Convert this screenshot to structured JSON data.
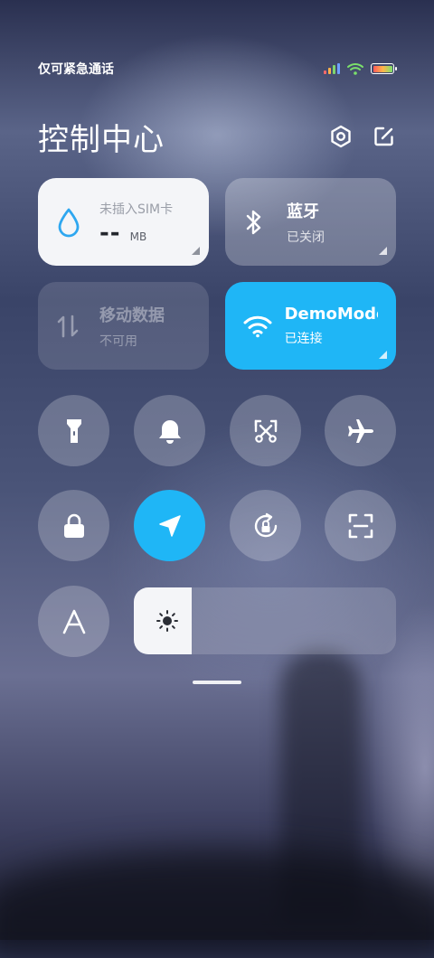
{
  "status_bar": {
    "carrier_text": "仅可紧急通话",
    "signal_icon": "signal-bars-icon",
    "wifi_icon": "wifi-icon",
    "battery_icon": "battery-icon"
  },
  "header": {
    "title": "控制中心",
    "settings_icon": "settings-hexagon-icon",
    "edit_icon": "edit-icon"
  },
  "tiles": {
    "data_usage": {
      "label": "未插入SIM卡",
      "value": "--",
      "unit": "MB",
      "icon": "water-drop-icon"
    },
    "bluetooth": {
      "title": "蓝牙",
      "status": "已关闭",
      "icon": "bluetooth-icon"
    },
    "mobile_data": {
      "title": "移动数据",
      "status": "不可用",
      "icon": "mobile-data-arrows-icon"
    },
    "wifi": {
      "title": "DemoMode",
      "status": "已连接",
      "icon": "wifi-icon"
    }
  },
  "toggles": [
    {
      "name": "flashlight",
      "icon": "flashlight-icon",
      "active": false
    },
    {
      "name": "ringer",
      "icon": "bell-icon",
      "active": false
    },
    {
      "name": "screenshot",
      "icon": "scissors-screenshot-icon",
      "active": false
    },
    {
      "name": "airplane-mode",
      "icon": "airplane-icon",
      "active": false
    },
    {
      "name": "lock-screen",
      "icon": "lock-icon",
      "active": false
    },
    {
      "name": "location",
      "icon": "location-arrow-icon",
      "active": true
    },
    {
      "name": "auto-rotate",
      "icon": "rotation-lock-icon",
      "active": false
    },
    {
      "name": "scanner",
      "icon": "scan-frame-icon",
      "active": false
    },
    {
      "name": "auto-brightness",
      "icon": "letter-a-icon",
      "active": false
    }
  ],
  "brightness": {
    "level": 0.22,
    "icon": "sun-icon"
  },
  "colors": {
    "accent": "#1fb6f6",
    "tile_light": "#f4f5f8",
    "data_icon": "#2ea7f0"
  }
}
